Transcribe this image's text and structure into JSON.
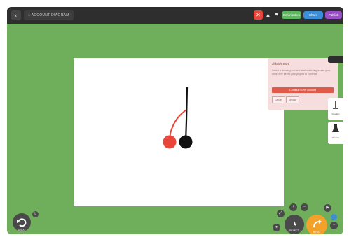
{
  "topbar": {
    "back_glyph": "‹",
    "breadcrumb": "● ACCOUNT DIAGRAM",
    "icons": [
      "tool-icon",
      "bell-icon",
      "flag-icon"
    ],
    "pills": [
      {
        "label": "Contributors",
        "color": "#5cb85c"
      },
      {
        "label": "Share",
        "color": "#3b8fd9"
      },
      {
        "label": "Publish",
        "color": "#9a4fc9"
      }
    ]
  },
  "panel": {
    "title": "Attach card",
    "text": "Select a drawing tool and start sketching to see your work here below your project to continue",
    "primary": "Continue to my account",
    "cancel": "Cancel",
    "upload": "Upload"
  },
  "side_tabs": {
    "labels": [
      "Visualizer",
      "Materials",
      "Measurements"
    ]
  },
  "bottom": {
    "left_label": "UNDO",
    "select_label": "SELECT",
    "primary_label": "REDO"
  },
  "colors": {
    "background": "#6fae5a",
    "topbar": "#2e2e2e",
    "accent_red": "#e8463a",
    "accent_orange": "#f2a12a"
  }
}
